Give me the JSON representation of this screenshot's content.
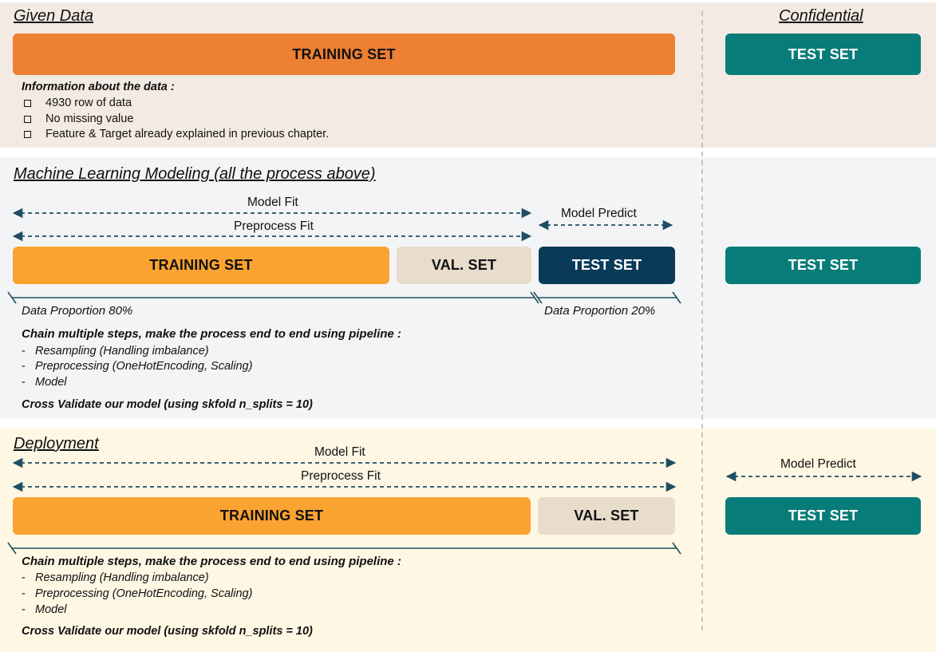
{
  "colors": {
    "band_given": "#f3ebe3",
    "band_ml": "#f3f4f6",
    "band_deploy": "#fef7e3",
    "training_given": "#ee8033",
    "training": "#fba331",
    "val_set": "#e8dccb",
    "test_dark": "#093a58",
    "test_teal": "#087c78",
    "arrow": "#1f4e63",
    "divider": "#b8b8b8"
  },
  "given": {
    "heading": "Given Data",
    "training_label": "TRAINING SET",
    "info_title": "Information about the data :",
    "items": [
      "4930 row of data",
      "No missing value",
      "Feature & Target already explained in previous chapter."
    ]
  },
  "confidential": {
    "heading": "Confidential",
    "test_label": "TEST SET"
  },
  "ml": {
    "heading": "Machine Learning Modeling (all the process above)",
    "model_fit": "Model Fit",
    "preprocess_fit": "Preprocess Fit",
    "model_predict": "Model Predict",
    "training_label": "TRAINING SET",
    "val_label": "VAL. SET",
    "test_label": "TEST SET",
    "proportion_train": "Data Proportion 80%",
    "proportion_test": "Data Proportion 20%",
    "chain_title": "Chain multiple steps, make the process end to end using pipeline :",
    "steps": [
      "Resampling (Handling imbalance)",
      "Preprocessing (OneHotEncoding, Scaling)",
      "Model"
    ],
    "cv": "Cross Validate our model (using skfold n_splits = 10)",
    "right_test_label": "TEST SET"
  },
  "deploy": {
    "heading": "Deployment",
    "model_fit": "Model Fit",
    "preprocess_fit": "Preprocess Fit",
    "model_predict": "Model Predict",
    "training_label": "TRAINING SET",
    "val_label": "VAL. SET",
    "test_label": "TEST SET",
    "chain_title": "Chain multiple steps, make the process end to end using pipeline :",
    "steps": [
      "Resampling (Handling imbalance)",
      "Preprocessing (OneHotEncoding, Scaling)",
      "Model"
    ],
    "cv": "Cross Validate our model (using skfold n_splits = 10)"
  },
  "dash_glyph": "-"
}
